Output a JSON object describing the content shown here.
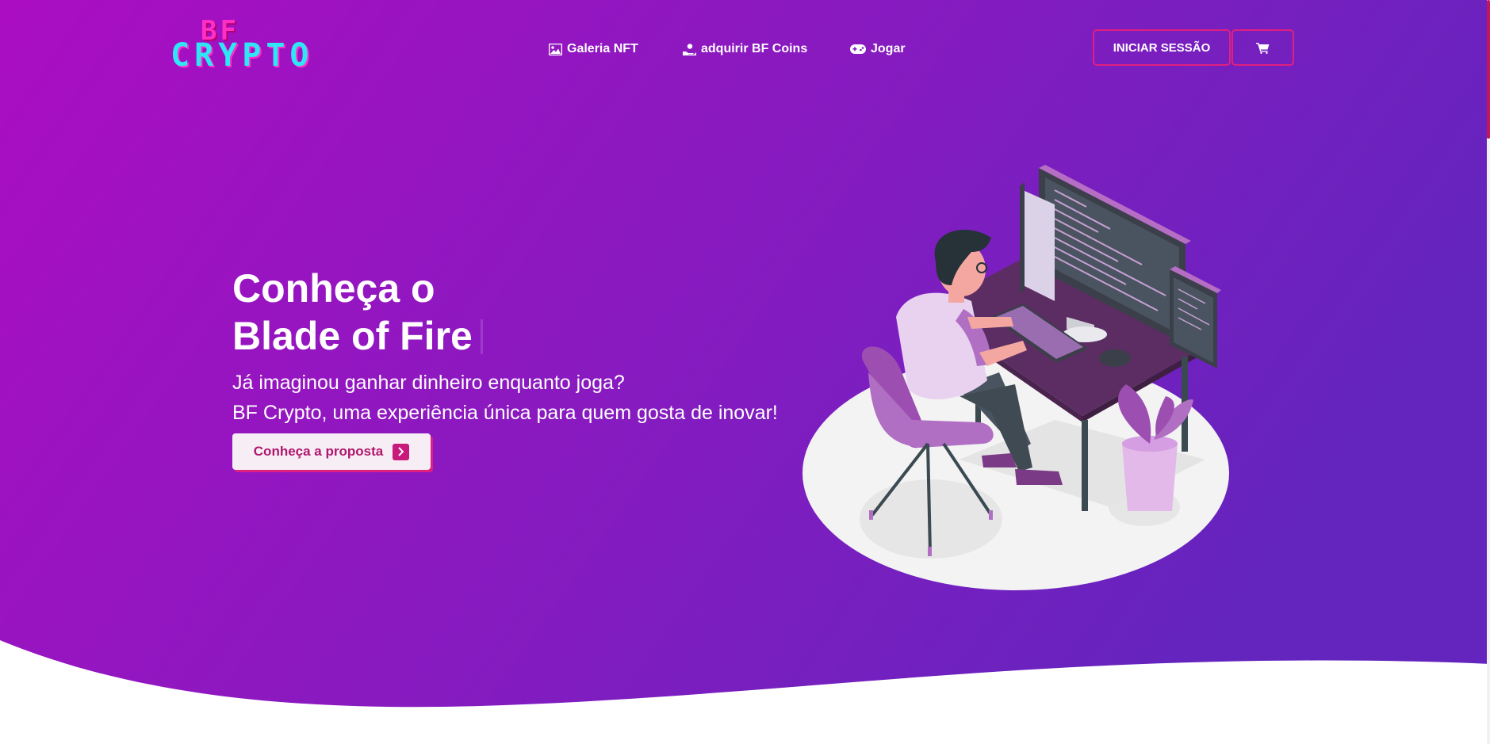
{
  "header": {
    "logo_line1": "BF",
    "logo_line2": "CRYPTO",
    "nav": [
      {
        "label": "Galeria NFT",
        "icon": "image-icon"
      },
      {
        "label": "adquirir BF Coins",
        "icon": "hand-coin-icon"
      },
      {
        "label": "Jogar",
        "icon": "gamepad-icon"
      }
    ],
    "login_label": "INICIAR SESSÃO",
    "cart_icon": "cart-icon"
  },
  "hero": {
    "title_line1": "Conheça o",
    "title_line2": "Blade of Fire",
    "subtitle_line1": "Já imaginou ganhar dinheiro enquanto joga?",
    "subtitle_line2": "BF Crypto, uma experiência única para quem gosta de inovar!",
    "cta_label": "Conheça a proposta",
    "cta_icon": "chevron-right-icon"
  },
  "colors": {
    "gradient_left": "#ab0dc2",
    "gradient_right": "#6424be",
    "accent": "#e0207e",
    "logo_pink": "#ff2ec4",
    "logo_cyan": "#2ee6f6"
  }
}
